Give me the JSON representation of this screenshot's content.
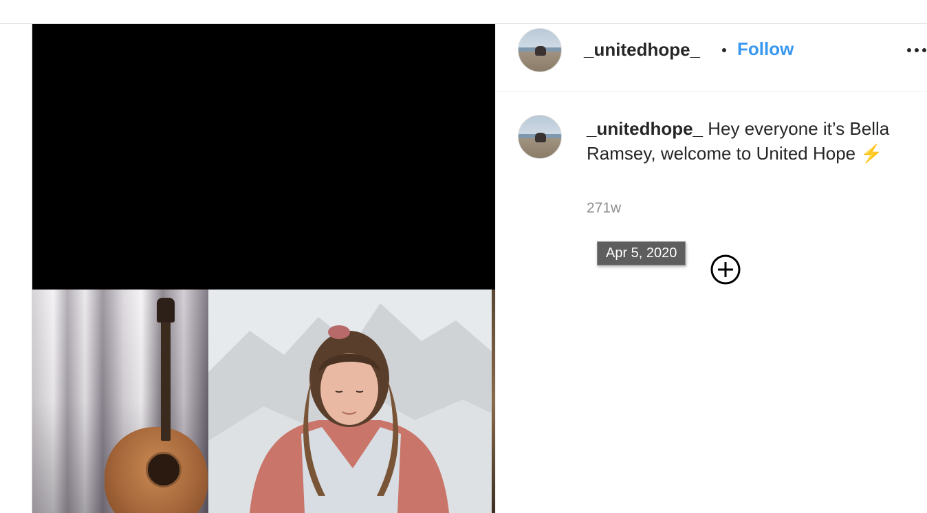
{
  "post": {
    "username": "_unitedhope_",
    "follow_label": "Follow",
    "separator": "•"
  },
  "caption": {
    "username": "_unitedhope_",
    "text": " Hey everyone it’s Bella Ramsey, welcome to United Hope ",
    "emoji": "⚡️",
    "time_ago": "271w",
    "tooltip_date": "Apr 5, 2020"
  },
  "icons": {
    "more": "more-options-icon",
    "cursor": "add-circle-icon"
  },
  "colors": {
    "accent": "#3897f0",
    "text": "#262626",
    "muted": "#8e8e8e"
  }
}
